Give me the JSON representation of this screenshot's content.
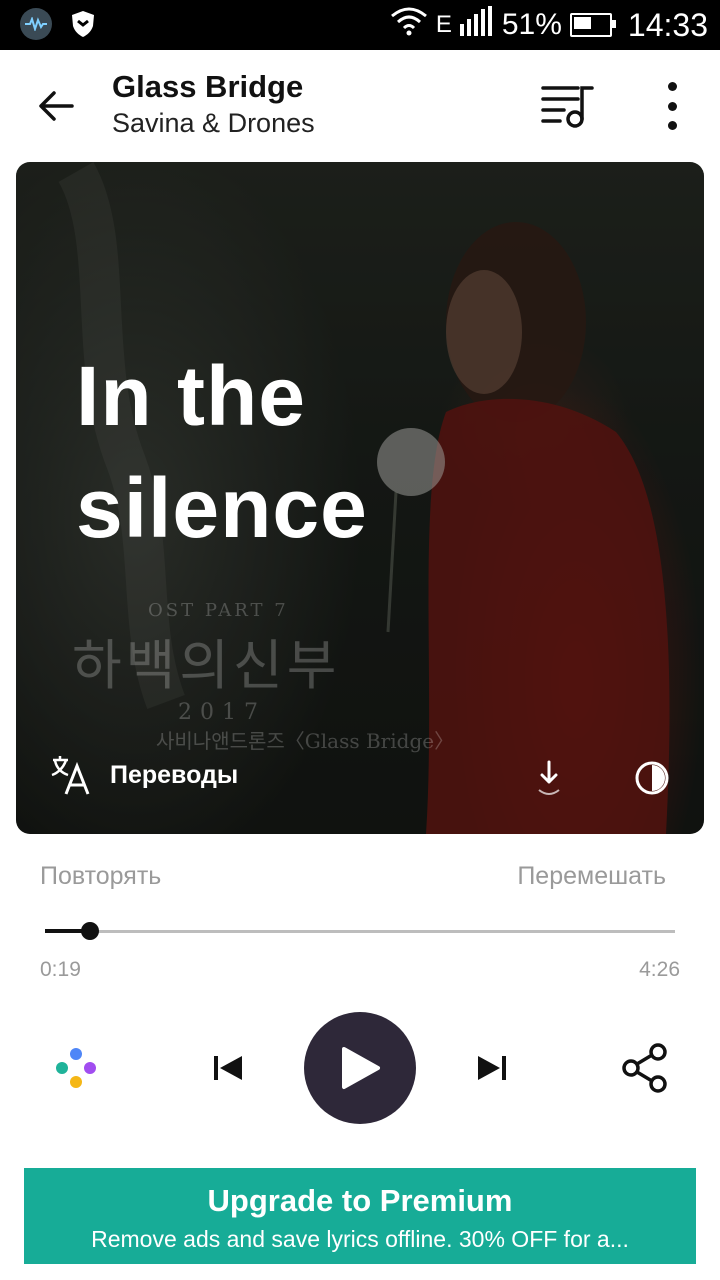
{
  "status_bar": {
    "battery_percent": "51%",
    "battery_level": 0.51,
    "time": "14:33",
    "network_type": "E",
    "icons": [
      "app-notification-icon",
      "shield-icon",
      "wifi-icon",
      "signal-icon",
      "battery-charging-icon"
    ]
  },
  "header": {
    "title": "Glass Bridge",
    "artist": "Savina & Drones",
    "icons": [
      "back-arrow-icon",
      "queue-music-icon",
      "more-vertical-icon"
    ]
  },
  "lyrics_card": {
    "lyric_lines": [
      "In the",
      "silence"
    ],
    "art_caption": {
      "ost": "OST PART 7",
      "korean_title": "하백의신부",
      "year": "2017",
      "subtitle": "사비나앤드론즈〈Glass Bridge〉"
    },
    "translate_label": "Переводы",
    "icons": [
      "translate-icon",
      "download-icon",
      "contrast-icon"
    ]
  },
  "playback": {
    "repeat_label": "Повторять",
    "shuffle_label": "Перемешать",
    "current_time": "0:19",
    "total_time": "4:26",
    "progress_fraction": 0.071
  },
  "controls": {
    "icons": [
      "google-assistant-icon",
      "skip-previous-icon",
      "play-icon",
      "skip-next-icon",
      "share-icon"
    ]
  },
  "premium_banner": {
    "title": "Upgrade to Premium",
    "subtitle": "Remove ads and save lyrics offline. 30% OFF for a..."
  },
  "colors": {
    "play_button": "#2e2839",
    "premium_banner": "#17ac97",
    "muted_text": "#9a9a9a"
  }
}
